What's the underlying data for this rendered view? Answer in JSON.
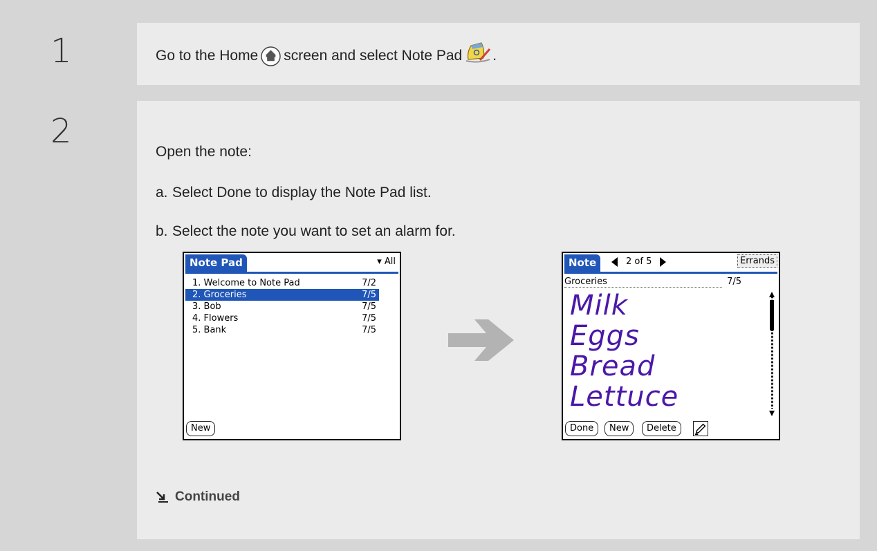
{
  "steps": [
    {
      "number": "1",
      "text_before_home": "Go to the Home",
      "text_after_home": "screen and select Note Pad",
      "text_end": "."
    },
    {
      "number": "2",
      "intro": "Open the note:",
      "substeps": [
        {
          "letter": "a.",
          "text": "Select Done to display the Note Pad list."
        },
        {
          "letter": "b.",
          "text": "Select the note you want to set an alarm for."
        }
      ]
    }
  ],
  "icons": {
    "home": "home-icon",
    "note_pad": "note-pad-icon",
    "arrow": "right-arrow-icon",
    "continued": "continued-arrow-icon",
    "pen": "pen-icon"
  },
  "list_screen": {
    "tab": "Note Pad",
    "category": "▾ All",
    "rows": [
      {
        "label": "1. Welcome to Note Pad",
        "date": "7/2",
        "selected": false
      },
      {
        "label": "2. Groceries",
        "date": "7/5",
        "selected": true
      },
      {
        "label": "3. Bob",
        "date": "7/5",
        "selected": false
      },
      {
        "label": "4. Flowers",
        "date": "7/5",
        "selected": false
      },
      {
        "label": "5. Bank",
        "date": "7/5",
        "selected": false
      }
    ],
    "new_button": "New"
  },
  "note_screen": {
    "tab": "Note",
    "position": "2 of 5",
    "category": "Errands",
    "title": "Groceries",
    "date": "7/5",
    "handwriting": [
      "Milk",
      "Eggs",
      "Bread",
      "Lettuce"
    ],
    "buttons": {
      "done": "Done",
      "new": "New",
      "delete": "Delete"
    }
  },
  "continued": "Continued",
  "colors": {
    "accent": "#1f56b8",
    "ink": "#4b18a8",
    "arrow": "#b3b3b3"
  }
}
